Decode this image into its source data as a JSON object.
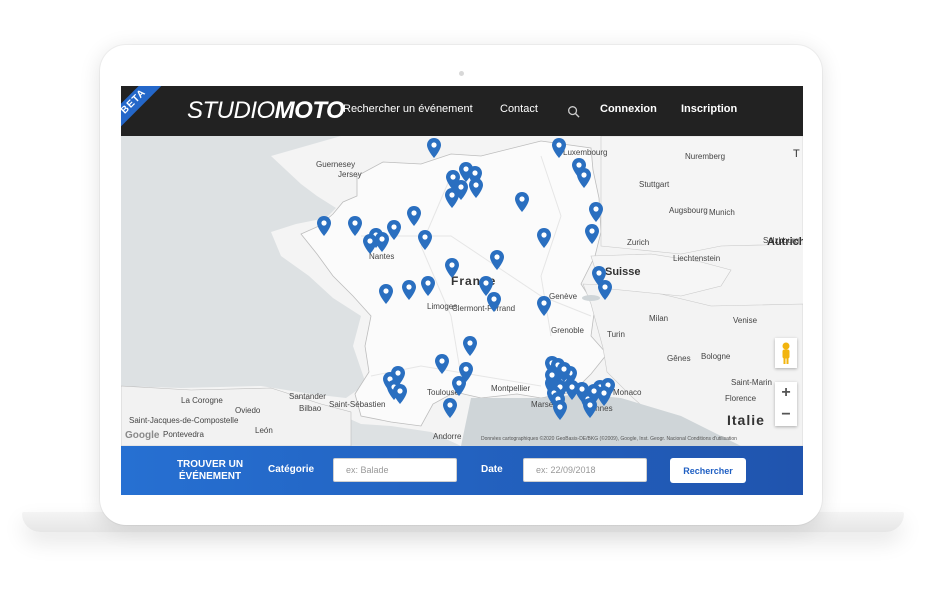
{
  "header": {
    "beta_label": "BETA",
    "logo_part1": "STUDIO",
    "logo_part2": "MOTO",
    "nav": {
      "search_event": "Rechercher un événement",
      "contact": "Contact",
      "login": "Connexion",
      "signup": "Inscription"
    },
    "icons": {
      "search": "search-icon"
    }
  },
  "map": {
    "places": {
      "guernsey": "Guernesey",
      "jersey": "Jersey",
      "france": "France",
      "nantes": "Nantes",
      "limoges": "Limoges",
      "clermont": "Clermont-Ferrand",
      "geneve": "Genève",
      "grenoble": "Grenoble",
      "toulouse": "Toulouse",
      "montpellier": "Montpellier",
      "marseille": "Marseille",
      "cannes": "Cannes",
      "monaco": "Monaco",
      "andorre": "Andorre",
      "bilbao": "Bilbao",
      "lacorogne": "La Corogne",
      "oviedo": "Oviedo",
      "santander": "Santander",
      "saintsebastien": "Saint-Sébastien",
      "saintjacques": "Saint-Jacques-de-Compostelle",
      "pontevedra": "Pontevedra",
      "leon": "León",
      "luxembourg": "Luxembourg",
      "nuremberg": "Nuremberg",
      "stuttgart": "Stuttgart",
      "augsbourg": "Augsbourg",
      "munich": "Munich",
      "zurich": "Zurich",
      "liechtenstein": "Liechtenstein",
      "salzbourg": "Salzbourg",
      "autriche": "Autrich",
      "suisse": "Suisse",
      "milan": "Milan",
      "turin": "Turin",
      "genes": "Gênes",
      "bologne": "Bologne",
      "venise": "Venise",
      "florence": "Florence",
      "saintmarin": "Saint-Marin",
      "italie": "Italie",
      "t": "T"
    },
    "pin_color": "#2a6fc0",
    "marker_count": 60,
    "zoom_in": "+",
    "zoom_out": "−",
    "google_label": "Google",
    "attribution": "Données cartographiques ©2020 GeoBasis-DE/BKG (©2009), Google, Inst. Geogr. Nacional     Conditions d'utilisation",
    "icons": {
      "pin": "map-pin-icon",
      "pegman": "street-view-pegman-icon"
    }
  },
  "search": {
    "title": "TROUVER UN ÉVÉNEMENT",
    "category_label": "Catégorie",
    "category_placeholder": "ex: Balade",
    "date_label": "Date",
    "date_placeholder": "ex: 22/09/2018",
    "button_label": "Rechercher"
  }
}
